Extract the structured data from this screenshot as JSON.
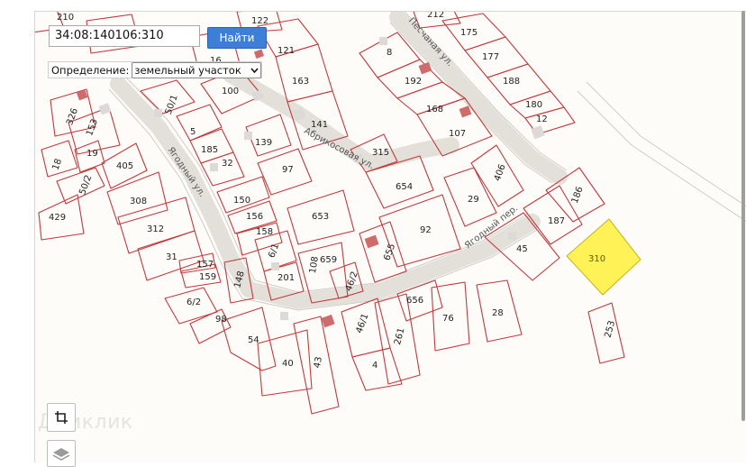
{
  "search": {
    "value": "34:08:140106:310",
    "button_label": "Найти"
  },
  "definition": {
    "label": "Определение:",
    "selected": "земельный участок"
  },
  "watermark": "Домклик",
  "streets": [
    "Ягодный ул.",
    "Абрикосовая ул.",
    "Песчаная ул.",
    "Ягодный пер."
  ],
  "highlight_color": "#fef257",
  "parcel_color": "#c0393b",
  "icons": [
    "chevron-down-icon",
    "crop-icon",
    "layers-icon"
  ],
  "parcels": [
    "310",
    "175",
    "177",
    "188",
    "180",
    "12",
    "107",
    "168",
    "192",
    "8",
    "121",
    "163",
    "141",
    "100",
    "50/1",
    "5",
    "185",
    "32",
    "139",
    "97",
    "315",
    "654",
    "29",
    "406",
    "186",
    "187",
    "45",
    "92",
    "653",
    "150",
    "156",
    "158",
    "6/1",
    "201",
    "108",
    "659",
    "46/2",
    "655",
    "656",
    "76",
    "28",
    "253",
    "46/1",
    "261",
    "4",
    "40",
    "43",
    "54",
    "98",
    "6/2",
    "148",
    "159",
    "157",
    "31",
    "312",
    "308",
    "405",
    "429",
    "50/2",
    "18",
    "19",
    "153",
    "326",
    "210",
    "122",
    "212",
    "16"
  ]
}
